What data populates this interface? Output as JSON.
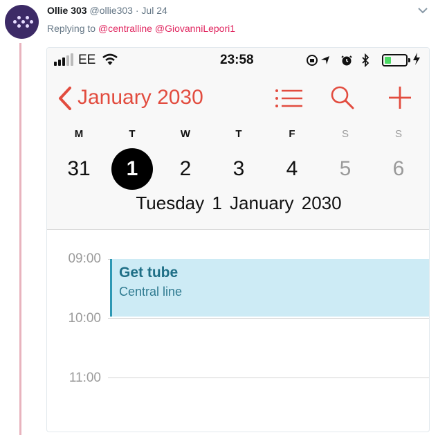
{
  "tweet": {
    "author_name": "Ollie 303",
    "author_handle": "@ollie303",
    "separator": "·",
    "date": "Jul 24",
    "reply_prefix": "Replying to",
    "reply_to": [
      "@centralline",
      "@GiovanniLepori1"
    ]
  },
  "status_bar": {
    "carrier": "EE",
    "time": "23:58",
    "battery_level": 0.3,
    "battery_color": "#4cd964"
  },
  "calendar": {
    "accent_color": "#e24c3f",
    "back_label": "January 2030",
    "icons": [
      "chevron-left-icon",
      "list-icon",
      "search-icon",
      "plus-icon"
    ],
    "weekdays": [
      "M",
      "T",
      "W",
      "T",
      "F",
      "S",
      "S"
    ],
    "dates": [
      "31",
      "1",
      "2",
      "3",
      "4",
      "5",
      "6"
    ],
    "selected_index": 1,
    "selected_date": "Tuesday  1 January 2030",
    "hours": [
      "09:00",
      "10:00",
      "11:00"
    ],
    "event": {
      "title": "Get tube",
      "location": "Central line",
      "start": "09:00",
      "end": "10:00",
      "color": "#cdebf5"
    }
  }
}
